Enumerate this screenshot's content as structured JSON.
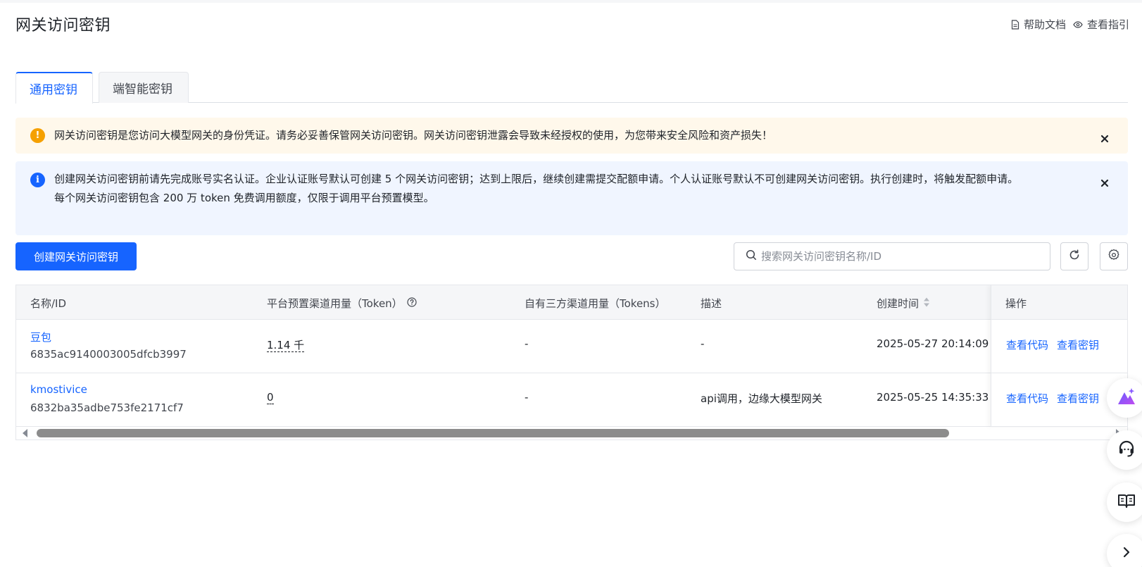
{
  "page": {
    "title": "网关访问密钥",
    "links": {
      "help_docs": "帮助文档",
      "view_guide": "查看指引"
    }
  },
  "tabs": [
    {
      "label": "通用密钥",
      "active": true
    },
    {
      "label": "端智能密钥",
      "active": false
    }
  ],
  "alerts": {
    "warning": {
      "text": "网关访问密钥是您访问大模型网关的身份凭证。请务必妥善保管网关访问密钥。网关访问密钥泄露会导致未经授权的使用，为您带来安全风险和资产损失！",
      "icon": "exclamation-icon",
      "color": "#f5a000"
    },
    "info": {
      "line1": "创建网关访问密钥前请先完成账号实名认证。企业认证账号默认可创建 5 个网关访问密钥；达到上限后，继续创建需提交配额申请。个人认证账号默认不可创建网关访问密钥。执行创建时，将触发配额申请。",
      "line2": "每个网关访问密钥包含 200 万 token 免费调用额度，仅限于调用平台预置模型。",
      "icon": "info-icon",
      "color": "#1664ff"
    }
  },
  "toolbar": {
    "create_label": "创建网关访问密钥",
    "search_placeholder": "搜索网关访问密钥名称/ID",
    "search_value": ""
  },
  "table": {
    "columns": {
      "name": "名称/ID",
      "platform_usage": "平台预置渠道用量（Token）",
      "third_party_usage": "自有三方渠道用量（Tokens）",
      "description": "描述",
      "created_at": "创建时间",
      "actions": "操作"
    },
    "rows": [
      {
        "name": "豆包",
        "id": "6835ac9140003005dfcb3997",
        "platform_usage": "1.14 千",
        "third_party_usage": "-",
        "description": "-",
        "created_at": "2025-05-27 20:14:09",
        "action_code": "查看代码",
        "action_key": "查看密钥"
      },
      {
        "name": "kmostivice",
        "id": "6832ba35adbe753fe2171cf7",
        "platform_usage": "0",
        "third_party_usage": "-",
        "description": "api调用，边缘大模型网关",
        "created_at": "2025-05-25 14:35:33",
        "action_code": "查看代码",
        "action_key": "查看密钥"
      }
    ],
    "scroll_position": 0.0
  },
  "theme": {
    "accent": "#1664ff",
    "warning_bg": "#fff8eb",
    "info_bg": "#f0f5ff"
  }
}
